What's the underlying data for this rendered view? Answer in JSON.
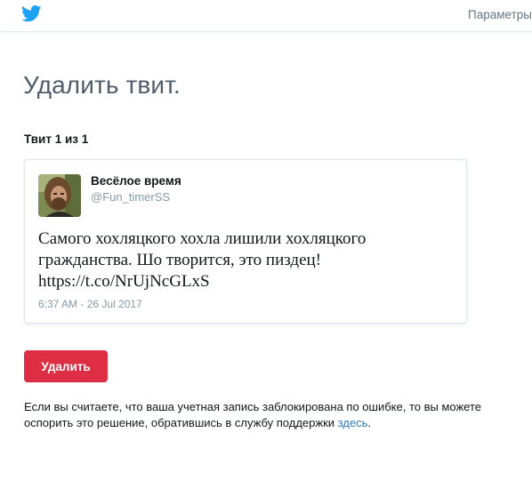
{
  "header": {
    "logo_icon": "twitter-bird-icon",
    "settings_label": "Параметры"
  },
  "page": {
    "title": "Удалить твит.",
    "tweet_count": "Твит 1 из 1"
  },
  "tweet": {
    "avatar_icon": "user-avatar",
    "display_name": "Весёлое время",
    "screen_name": "@Fun_timerSS",
    "text_line1": "Самого хохляцкого хохла лишили хохляцкого",
    "text_line2": "гражданства. Шо творится, это пиздец!",
    "text_line3": "https://t.co/NrUjNcGLxS",
    "timestamp": "6:37 AM - 26 Jul 2017"
  },
  "actions": {
    "delete_label": "Удалить"
  },
  "appeal": {
    "text_before": "Если вы считаете, что ваша учетная запись заблокирована по ошибке, то вы можете оспорить это решение, обратившись в службу поддержки ",
    "link_label": "здесь",
    "text_after": "."
  },
  "colors": {
    "brand_blue": "#1da1f2",
    "delete_red": "#dd2e44",
    "link_blue": "#2b7bb9",
    "title_gray": "#505d6a"
  }
}
